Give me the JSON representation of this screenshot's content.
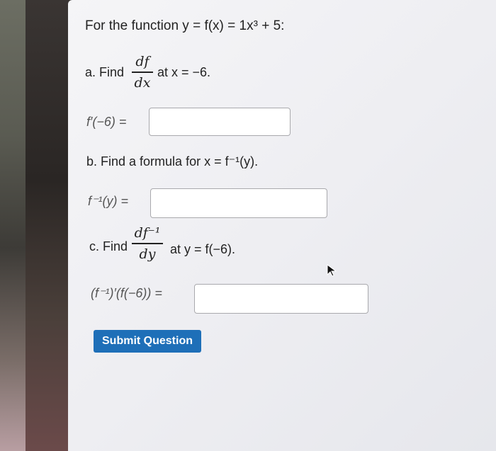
{
  "problem": {
    "intro": "For the function y = f(x) = 1x³ + 5:",
    "part_a": {
      "prefix": "a. Find",
      "frac_num": "df",
      "frac_den": "dx",
      "suffix": "at x = −6.",
      "answer_label": "f′(−6) =",
      "answer_value": ""
    },
    "part_b": {
      "prompt": "b. Find a formula for x = f⁻¹(y).",
      "answer_label": "f⁻¹(y) =",
      "answer_value": ""
    },
    "part_c": {
      "prefix": "c. Find",
      "frac_num": "df⁻¹",
      "frac_den": "dy",
      "suffix": "at y = f(−6).",
      "answer_label": "(f⁻¹)′(f(−6)) =",
      "answer_value": ""
    }
  },
  "submit_label": "Submit Question",
  "colors": {
    "submit_bg": "#1e6fb8",
    "text": "#222222"
  },
  "icons": {
    "cursor": "arrow-cursor-icon"
  }
}
